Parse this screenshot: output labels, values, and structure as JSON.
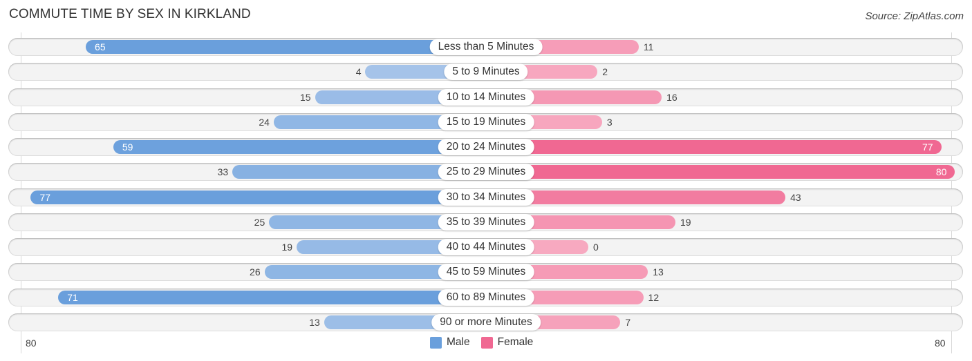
{
  "chart_data": {
    "type": "bar",
    "orientation": "horizontal-diverging",
    "title": "COMMUTE TIME BY SEX IN KIRKLAND",
    "source": "Source: ZipAtlas.com",
    "categories": [
      "Less than 5 Minutes",
      "5 to 9 Minutes",
      "10 to 14 Minutes",
      "15 to 19 Minutes",
      "20 to 24 Minutes",
      "25 to 29 Minutes",
      "30 to 34 Minutes",
      "35 to 39 Minutes",
      "40 to 44 Minutes",
      "45 to 59 Minutes",
      "60 to 89 Minutes",
      "90 or more Minutes"
    ],
    "series": [
      {
        "name": "Male",
        "color": "#6a9fdc",
        "light_color": "#a9c6ea",
        "values": [
          65,
          4,
          15,
          24,
          59,
          33,
          77,
          25,
          19,
          26,
          71,
          13
        ]
      },
      {
        "name": "Female",
        "color": "#f06892",
        "light_color": "#f7a9c0",
        "values": [
          11,
          2,
          16,
          3,
          77,
          80,
          43,
          19,
          0,
          13,
          12,
          7
        ]
      }
    ],
    "axis": {
      "left_label": "80",
      "right_label": "80",
      "max": 80
    },
    "legend": {
      "position": "bottom-center",
      "items": [
        "Male",
        "Female"
      ]
    },
    "grid": true
  }
}
